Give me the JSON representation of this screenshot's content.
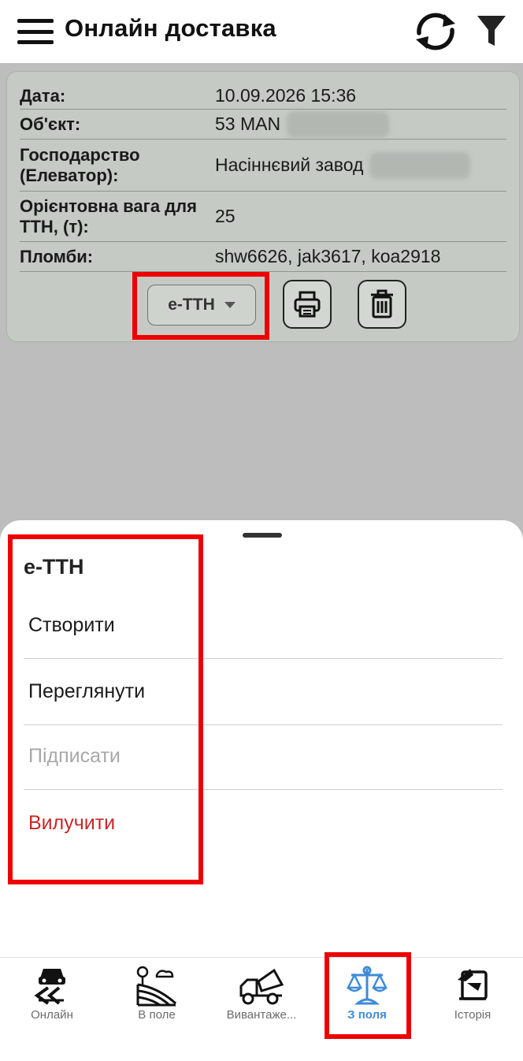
{
  "header": {
    "title": "Онлайн доставка",
    "menu_icon": "hamburger-menu-icon",
    "refresh_icon": "refresh-icon",
    "filter_icon": "filter-icon"
  },
  "card": {
    "rows": [
      {
        "label": "Дата:",
        "value": "10.09.2026 15:36"
      },
      {
        "label": "Об'єкт:",
        "value": "53 MAN"
      },
      {
        "label": "Господарство (Елеватор):",
        "value": "Насіннєвий завод"
      },
      {
        "label": "Орієнтовна вага для ТТН, (т):",
        "value": "25"
      },
      {
        "label": "Пломби:",
        "value": "shw6626, jak3617, koa2918"
      }
    ],
    "ettn_button": "е-ТТН",
    "print_icon": "printer-icon",
    "delete_icon": "trash-icon"
  },
  "sheet": {
    "title": "е-ТТН",
    "options": [
      {
        "label": "Створити",
        "color": "#1a1a1a"
      },
      {
        "label": "Переглянути",
        "color": "#1a1a1a"
      },
      {
        "label": "Підписати",
        "color": "#a8a8a8"
      },
      {
        "label": "Вилучити",
        "color": "#c62828"
      }
    ]
  },
  "nav": {
    "items": [
      {
        "label": "Онлайн",
        "icon": "road-icon"
      },
      {
        "label": "В поле",
        "icon": "field-icon"
      },
      {
        "label": "Вивантаже...",
        "icon": "dump-truck-icon"
      },
      {
        "label": "З поля",
        "icon": "scales-icon",
        "active": true
      },
      {
        "label": "Історія",
        "icon": "history-icon"
      }
    ],
    "active_color": "#3d8bd8"
  },
  "colors": {
    "highlight": "#ee0000",
    "overlay": "#bdbdbd"
  }
}
